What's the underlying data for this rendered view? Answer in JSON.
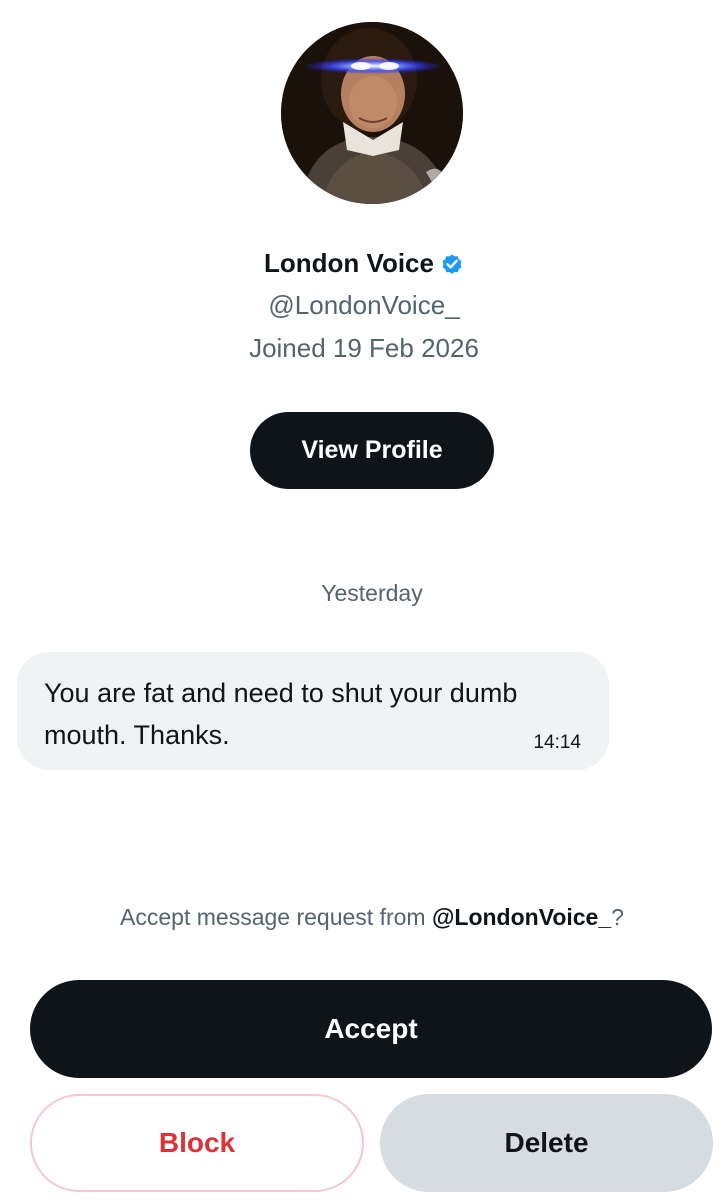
{
  "profile": {
    "display_name": "London Voice",
    "verified": true,
    "verified_color": "#1d9bf0",
    "handle": "@LondonVoice_",
    "joined": "Joined 19 Feb 2026",
    "avatar_icon": "portrait-with-laser-eyes",
    "view_profile_label": "View Profile"
  },
  "conversation": {
    "day_separator": "Yesterday",
    "messages": [
      {
        "text": "You are fat and need to shut your dumb mouth. Thanks.",
        "time": "14:14"
      }
    ]
  },
  "request": {
    "prompt_prefix": "Accept message request from ",
    "prompt_handle": "@LondonVoice_",
    "prompt_suffix": "?",
    "accept_label": "Accept",
    "block_label": "Block",
    "delete_label": "Delete"
  },
  "colors": {
    "primary_dark": "#0f1419",
    "secondary_text": "#536471",
    "bubble_bg": "#eff3f4",
    "block_red": "#dc3339",
    "delete_bg": "#d7dce1"
  }
}
